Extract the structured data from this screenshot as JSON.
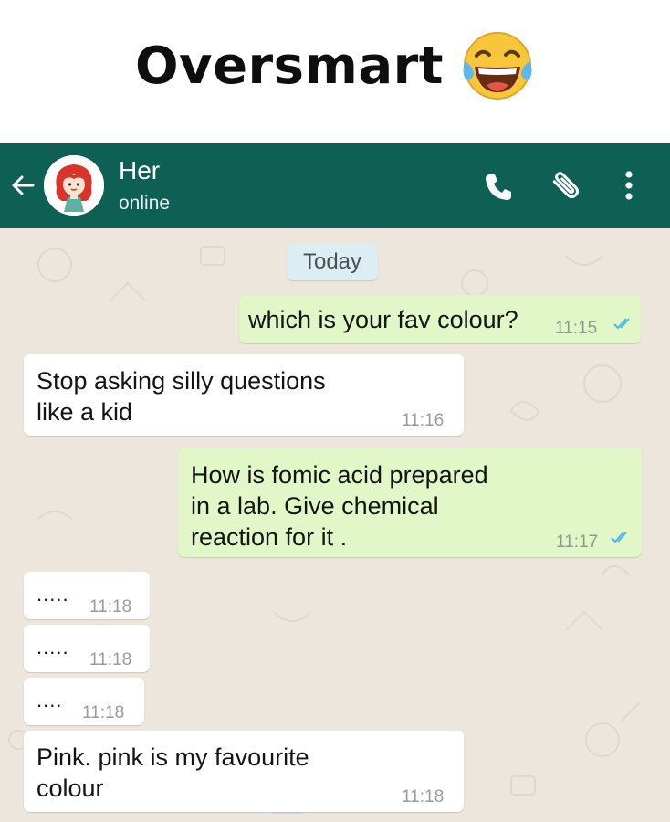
{
  "caption": {
    "title": "Oversmart"
  },
  "header": {
    "contact_name": "Her",
    "status": "online"
  },
  "chat": {
    "date_chip": "Today",
    "messages": [
      {
        "direction": "out",
        "text": "which is your fav colour?",
        "time": "11:15",
        "read": true
      },
      {
        "direction": "in",
        "line1": "Stop asking silly questions",
        "line2": "like a kid",
        "time": "11:16"
      },
      {
        "direction": "out",
        "line1": "How is fomic acid prepared",
        "line2": "in a lab. Give chemical",
        "line3": "reaction for it .",
        "time": "11:17",
        "read": true
      },
      {
        "direction": "in",
        "text": ".....",
        "time": "11:18"
      },
      {
        "direction": "in",
        "text": ".....",
        "time": "11:18"
      },
      {
        "direction": "in",
        "text": "....",
        "time": "11:18"
      },
      {
        "direction": "in",
        "line1": "Pink. pink is my favourite",
        "line2": "colour",
        "time": "11:18"
      }
    ]
  },
  "colors": {
    "header_bg": "#0f6054",
    "chat_bg": "#ece6dc",
    "outgoing_bubble": "#e1f7c8",
    "incoming_bubble": "#ffffff",
    "date_chip_bg": "#dbeef4",
    "read_ticks": "#4fb6ec"
  },
  "icons": [
    "tears-of-joy-emoji",
    "back-arrow-icon",
    "avatar",
    "phone-icon",
    "paperclip-icon",
    "more-vertical-icon",
    "double-tick-icon"
  ]
}
